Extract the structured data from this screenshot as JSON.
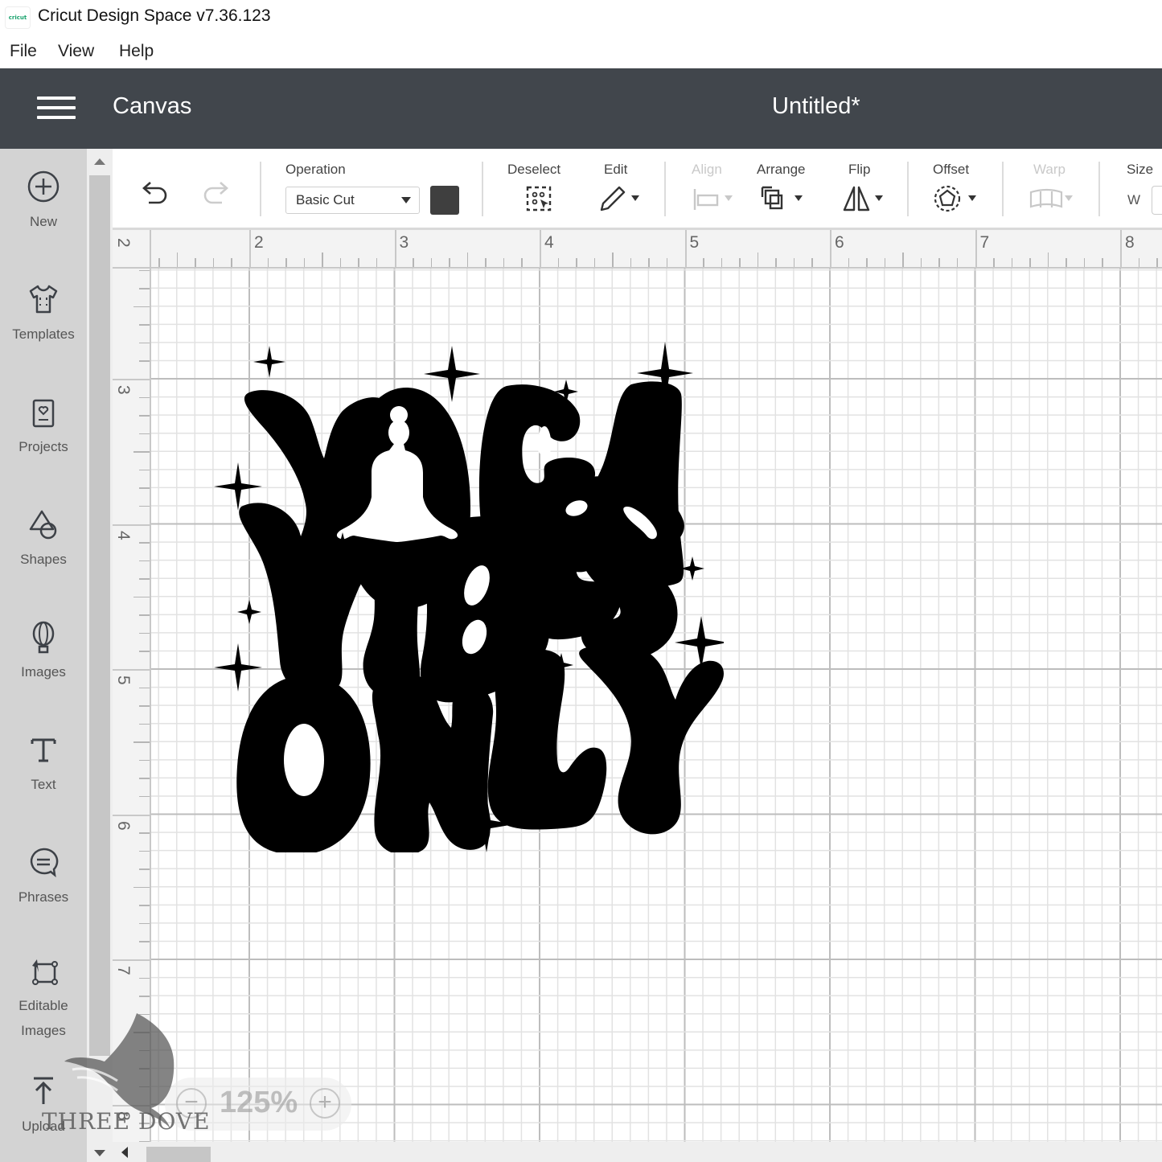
{
  "window": {
    "logo_text": "cricut",
    "title": "Cricut Design Space  v7.36.123"
  },
  "menubar": {
    "items": [
      {
        "label": "File"
      },
      {
        "label": "View"
      },
      {
        "label": "Help"
      }
    ]
  },
  "header": {
    "menu_icon": "hamburger-icon",
    "section": "Canvas",
    "project_title": "Untitled*"
  },
  "sidebar": {
    "items": [
      {
        "label": "New",
        "icon": "plus-circle-icon"
      },
      {
        "label": "Templates",
        "icon": "shirt-icon"
      },
      {
        "label": "Projects",
        "icon": "card-heart-icon"
      },
      {
        "label": "Shapes",
        "icon": "shapes-icon"
      },
      {
        "label": "Images",
        "icon": "balloon-icon"
      },
      {
        "label": "Text",
        "icon": "text-t-icon"
      },
      {
        "label": "Phrases",
        "icon": "speech-bubble-icon"
      },
      {
        "label": "Editable Images",
        "icon": "edit-image-icon"
      },
      {
        "label": "Upload",
        "icon": "upload-icon"
      }
    ]
  },
  "toolbar": {
    "undo_icon": "undo-icon",
    "redo_icon": "redo-icon",
    "operation_label": "Operation",
    "operation_value": "Basic Cut",
    "operation_color": "#3f3f3f",
    "deselect_label": "Deselect",
    "edit_label": "Edit",
    "align_label": "Align",
    "arrange_label": "Arrange",
    "flip_label": "Flip",
    "offset_label": "Offset",
    "warp_label": "Warp",
    "size_label": "Size",
    "size_w_label": "W"
  },
  "rulers": {
    "top": [
      "2",
      "2",
      "3",
      "4",
      "5",
      "6",
      "7",
      "8"
    ],
    "left": [
      "3",
      "4",
      "5",
      "6",
      "7",
      "8"
    ]
  },
  "canvas": {
    "design_lines": [
      "YOGA",
      "VIBES",
      "ONLY"
    ]
  },
  "zoom": {
    "value": "125%",
    "minus": "−",
    "plus": "+"
  },
  "watermark": {
    "text": "THREE DOVE"
  }
}
